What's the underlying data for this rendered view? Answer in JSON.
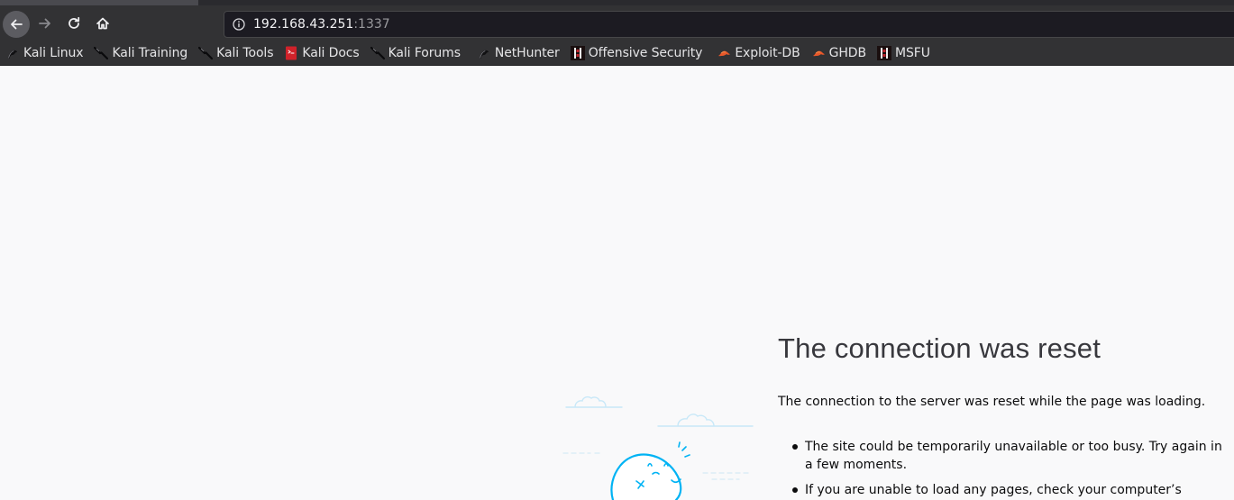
{
  "urlbar": {
    "host": "192.168.43.251",
    "port": ":1337"
  },
  "bookmarks": [
    {
      "label": "Kali Linux",
      "icon": "kali-dragon-icon"
    },
    {
      "label": "Kali Training",
      "icon": "kali-dragon-icon"
    },
    {
      "label": "Kali Tools",
      "icon": "kali-dragon-icon"
    },
    {
      "label": "Kali Docs",
      "icon": "kali-docs-icon"
    },
    {
      "label": "Kali Forums",
      "icon": "kali-dragon-icon"
    },
    {
      "label": "NetHunter",
      "icon": "nethunter-icon"
    },
    {
      "label": "Offensive Security",
      "icon": "offsec-icon"
    },
    {
      "label": "Exploit-DB",
      "icon": "exploitdb-icon"
    },
    {
      "label": "GHDB",
      "icon": "exploitdb-icon"
    },
    {
      "label": "MSFU",
      "icon": "offsec-icon"
    }
  ],
  "error": {
    "title": "The connection was reset",
    "description": "The connection to the server was reset while the page was loading.",
    "suggestions": [
      "The site could be temporarily unavailable or too busy. Try again in a few moments.",
      "If you are unable to load any pages, check your computer’s network"
    ]
  },
  "colors": {
    "chrome_bg": "#323234",
    "urlbar_bg": "#1c1b22",
    "page_bg": "#f9f9fa",
    "illustration_stroke": "#00b3f4"
  }
}
